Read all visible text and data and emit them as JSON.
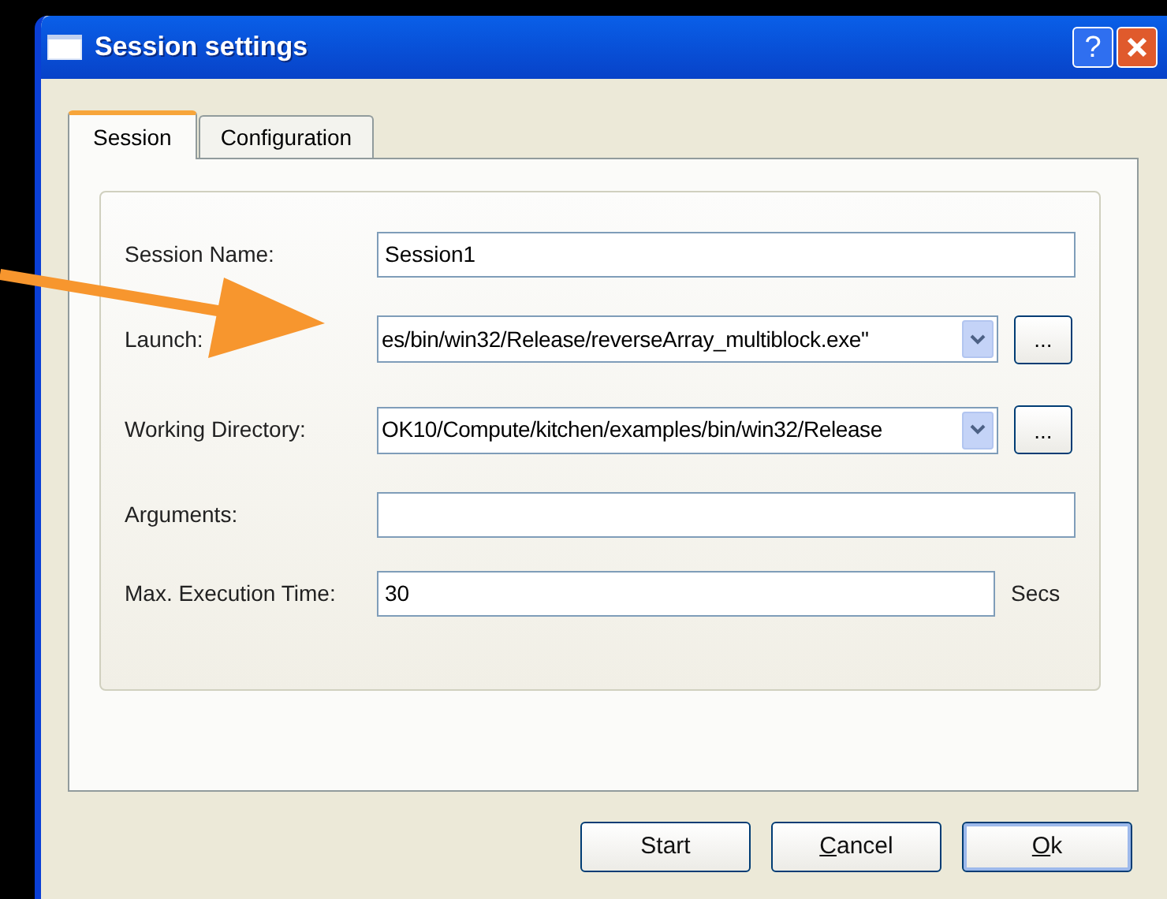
{
  "window": {
    "title": "Session settings",
    "help_button": "?"
  },
  "tabs": [
    {
      "label": "Session",
      "selected": true
    },
    {
      "label": "Configuration",
      "selected": false
    }
  ],
  "fields": [
    {
      "kind": "text",
      "label": "Session Name:",
      "value": "Session1"
    },
    {
      "kind": "combo",
      "label": "Launch:",
      "value": "es/bin/win32/Release/reverseArray_multiblock.exe\"",
      "browse": "..."
    },
    {
      "kind": "combo",
      "label": "Working Directory:",
      "value": "OK10/Compute/kitchen/examples/bin/win32/Release",
      "browse": "..."
    },
    {
      "kind": "text",
      "label": "Arguments:"
    },
    {
      "kind": "text",
      "label": "Max. Execution Time:",
      "value": "30",
      "unit": "Secs"
    }
  ],
  "buttons": [
    {
      "label": "Start",
      "access_key": false,
      "default": false
    },
    {
      "label": "Cancel",
      "access_key": true,
      "default": false
    },
    {
      "label": "Ok",
      "access_key": true,
      "default": true
    }
  ]
}
